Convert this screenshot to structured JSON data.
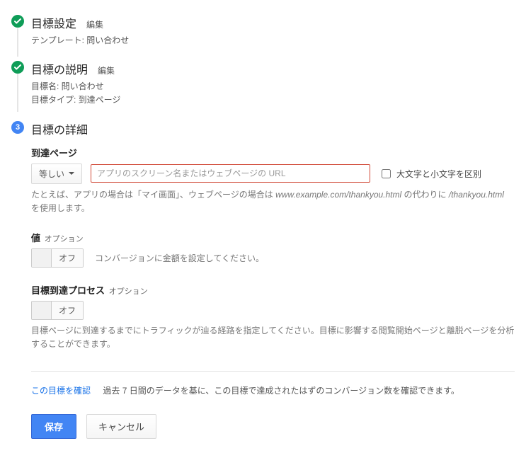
{
  "steps": {
    "s1": {
      "title": "目標設定",
      "edit": "編集",
      "sub": "テンプレート: 問い合わせ"
    },
    "s2": {
      "title": "目標の説明",
      "edit": "編集",
      "sub1": "目標名: 問い合わせ",
      "sub2": "目標タイプ: 到達ページ"
    },
    "s3": {
      "num": "3",
      "title": "目標の詳細"
    }
  },
  "dest": {
    "label": "到達ページ",
    "match_selected": "等しい",
    "url_placeholder": "アプリのスクリーン名またはウェブページの URL",
    "case_label": "大文字と小文字を区別",
    "help_a": "たとえば、アプリの場合は「マイ画面」、ウェブページの場合は ",
    "help_i": "www.example.com/thankyou.html",
    "help_b": " の代わりに ",
    "help_i2": "/thankyou.html",
    "help_c": " を使用します。"
  },
  "value_opt": {
    "head_bold": "値",
    "head_sub": "オプション",
    "toggle": "オフ",
    "help": "コンバージョンに金額を設定してください。"
  },
  "funnel_opt": {
    "head_bold": "目標到達プロセス",
    "head_sub": "オプション",
    "toggle": "オフ",
    "help": "目標ページに到達するまでにトラフィックが辿る経路を指定してください。目標に影響する閲覧開始ページと離脱ページを分析することができます。"
  },
  "verify": {
    "link": "この目標を確認",
    "text": "過去 7 日間のデータを基に、この目標で達成されたはずのコンバージョン数を確認できます。"
  },
  "actions": {
    "save": "保存",
    "cancel": "キャンセル"
  }
}
